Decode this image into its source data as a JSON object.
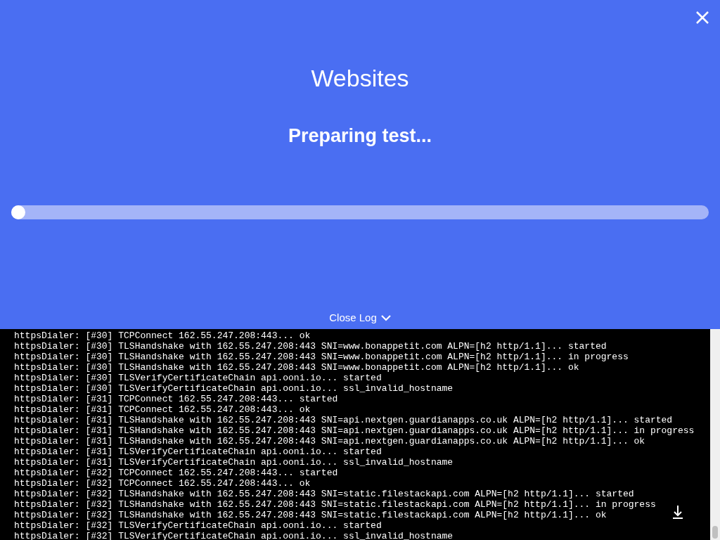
{
  "header": {
    "title": "Websites",
    "status": "Preparing test...",
    "progress": {
      "level": 0
    }
  },
  "log_toggle": {
    "label": "Close Log",
    "expanded": true
  },
  "log_lines": [
    "httpsDialer: [#30] TCPConnect 162.55.247.208:443... ok",
    "httpsDialer: [#30] TLSHandshake with 162.55.247.208:443 SNI=www.bonappetit.com ALPN=[h2 http/1.1]... started",
    "httpsDialer: [#30] TLSHandshake with 162.55.247.208:443 SNI=www.bonappetit.com ALPN=[h2 http/1.1]... in progress",
    "httpsDialer: [#30] TLSHandshake with 162.55.247.208:443 SNI=www.bonappetit.com ALPN=[h2 http/1.1]... ok",
    "httpsDialer: [#30] TLSVerifyCertificateChain api.ooni.io... started",
    "httpsDialer: [#30] TLSVerifyCertificateChain api.ooni.io... ssl_invalid_hostname",
    "httpsDialer: [#31] TCPConnect 162.55.247.208:443... started",
    "httpsDialer: [#31] TCPConnect 162.55.247.208:443... ok",
    "httpsDialer: [#31] TLSHandshake with 162.55.247.208:443 SNI=api.nextgen.guardianapps.co.uk ALPN=[h2 http/1.1]... started",
    "httpsDialer: [#31] TLSHandshake with 162.55.247.208:443 SNI=api.nextgen.guardianapps.co.uk ALPN=[h2 http/1.1]... in progress",
    "httpsDialer: [#31] TLSHandshake with 162.55.247.208:443 SNI=api.nextgen.guardianapps.co.uk ALPN=[h2 http/1.1]... ok",
    "httpsDialer: [#31] TLSVerifyCertificateChain api.ooni.io... started",
    "httpsDialer: [#31] TLSVerifyCertificateChain api.ooni.io... ssl_invalid_hostname",
    "httpsDialer: [#32] TCPConnect 162.55.247.208:443... started",
    "httpsDialer: [#32] TCPConnect 162.55.247.208:443... ok",
    "httpsDialer: [#32] TLSHandshake with 162.55.247.208:443 SNI=static.filestackapi.com ALPN=[h2 http/1.1]... started",
    "httpsDialer: [#32] TLSHandshake with 162.55.247.208:443 SNI=static.filestackapi.com ALPN=[h2 http/1.1]... in progress",
    "httpsDialer: [#32] TLSHandshake with 162.55.247.208:443 SNI=static.filestackapi.com ALPN=[h2 http/1.1]... ok",
    "httpsDialer: [#32] TLSVerifyCertificateChain api.ooni.io... started",
    "httpsDialer: [#32] TLSVerifyCertificateChain api.ooni.io... ssl_invalid_hostname"
  ]
}
